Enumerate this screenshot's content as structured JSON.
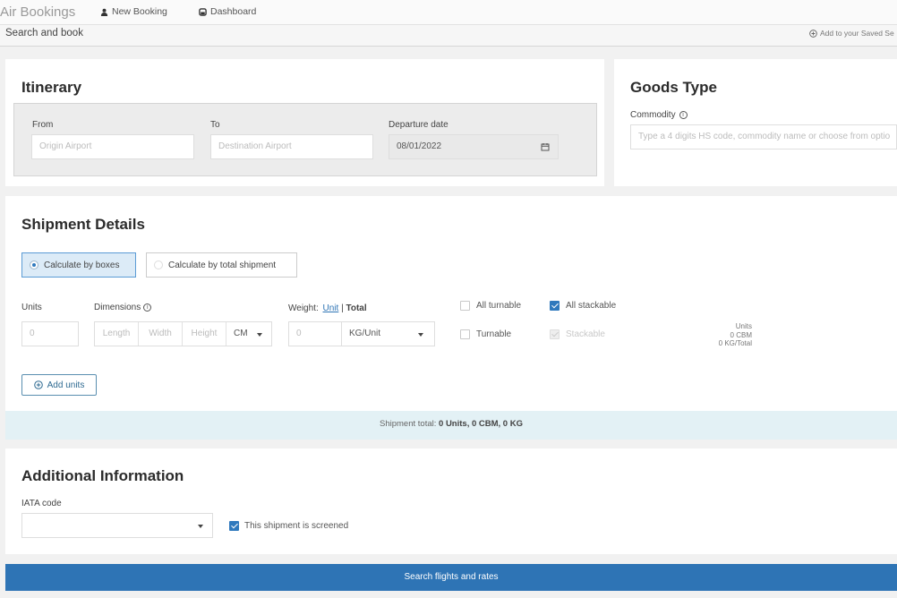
{
  "nav": {
    "brand": "Air Bookings",
    "new_booking": "New Booking",
    "dashboard": "Dashboard"
  },
  "subbar": {
    "title": "Search and book",
    "saved": "Add to your Saved Se"
  },
  "itinerary": {
    "title": "Itinerary",
    "from_label": "From",
    "from_placeholder": "Origin Airport",
    "to_label": "To",
    "to_placeholder": "Destination Airport",
    "date_label": "Departure date",
    "date_value": "08/01/2022"
  },
  "goods": {
    "title": "Goods Type",
    "commodity_label": "Commodity",
    "commodity_placeholder": "Type a 4 digits HS code, commodity name or choose from optio"
  },
  "shipment": {
    "title": "Shipment Details",
    "calc_boxes": "Calculate by boxes",
    "calc_total": "Calculate by total shipment",
    "units_label": "Units",
    "units_value": "0",
    "dimensions_label": "Dimensions",
    "length": "Length",
    "width": "Width",
    "height": "Height",
    "dim_unit": "CM",
    "weight_label": "Weight:",
    "weight_unit_link": "Unit",
    "weight_sep": "|",
    "weight_total": "Total",
    "weight_value": "0",
    "weight_unit": "KG/Unit",
    "all_turnable": "All turnable",
    "all_stackable": "All stackable",
    "turnable": "Turnable",
    "stackable": "Stackable",
    "summary_units": "Units",
    "summary_cbm": "0 CBM",
    "summary_kg": "0 KG/Total",
    "add_units": "Add units",
    "total_prefix": "Shipment total:",
    "total_value": "0 Units, 0 CBM, 0 KG"
  },
  "additional": {
    "title": "Additional Information",
    "iata_label": "IATA code",
    "screened_label": "This shipment is screened"
  },
  "search_button": "Search flights and rates",
  "colors": {
    "accent": "#2e74b5",
    "selected_bg": "#dcebf7",
    "total_bar_bg": "#e3f1f5"
  }
}
